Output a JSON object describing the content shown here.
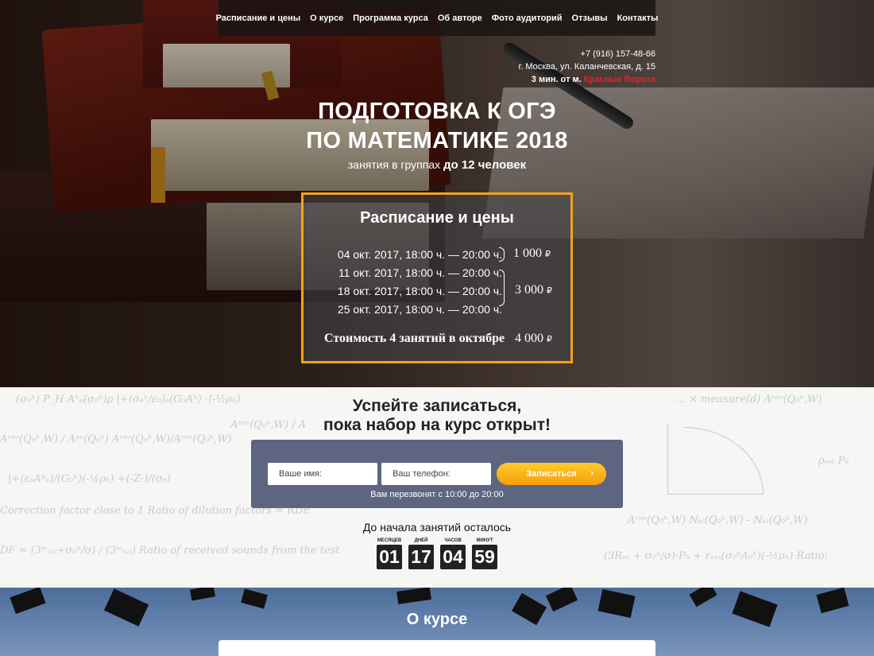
{
  "nav": {
    "items": [
      "Расписание и цены",
      "О курсе",
      "Программа курса",
      "Об авторе",
      "Фото аудиторий",
      "Отзывы",
      "Контакты"
    ]
  },
  "contacts": {
    "phone": "+7 (916) 157-48-66",
    "address": "г. Москва, ул. Каланчевская, д. 15",
    "metro_prefix": "3 мин. от м.",
    "metro_name": "Красные Ворота"
  },
  "hero": {
    "title_line1": "ПОДГОТОВКА К ОГЭ",
    "title_line2": "ПО МАТЕМАТИКЕ 2018",
    "subtitle_prefix": "занятия в группах",
    "subtitle_bold": "до 12 человек"
  },
  "pricebox": {
    "title": "Расписание и цены",
    "schedule": [
      "04 окт. 2017, 18:00 ч. — 20:00 ч.",
      "11 окт. 2017, 18:00 ч. — 20:00 ч.",
      "18 окт. 2017, 18:00 ч. — 20:00 ч.",
      "25 окт. 2017, 18:00 ч. — 20:00 ч."
    ],
    "price_single": "1 000",
    "price_three": "3 000",
    "total_label": "Стоимость 4 занятий в октябре",
    "total_price": "4 000",
    "currency": "₽"
  },
  "signup": {
    "heading_line1": "Успейте записаться,",
    "heading_line2": "пока набор на курс открыт!",
    "name_placeholder": "Ваше имя:",
    "phone_placeholder": "Ваш телефон:",
    "submit_label": "Записаться",
    "submit_arrow": "›",
    "callback_note": "Вам перезвонят с 10:00 до 20:00",
    "countdown_title": "До начала занятий осталось",
    "countdown": [
      {
        "label": "МЕСЯЦЕВ",
        "value": "01"
      },
      {
        "label": "ДНЕЙ",
        "value": "17"
      },
      {
        "label": "ЧАСОВ",
        "value": "04"
      },
      {
        "label": "МИНУТ",
        "value": "59"
      }
    ]
  },
  "about": {
    "heading": "О курсе"
  },
  "colors": {
    "accent_orange": "#f4a21a",
    "metro_red": "#e8202a",
    "form_bg": "#5d6580",
    "countdown_bg": "#222222"
  }
}
